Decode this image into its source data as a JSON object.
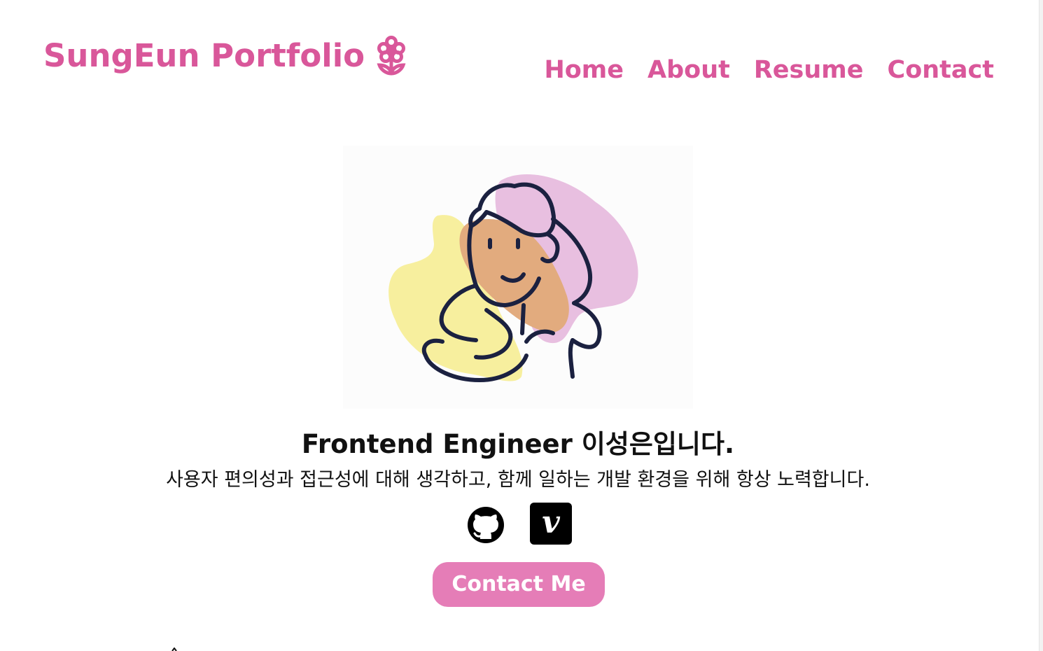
{
  "header": {
    "brand_text": "SungEun Portfolio",
    "brand_icon": "flower-icon",
    "nav": [
      {
        "label": "Home"
      },
      {
        "label": "About"
      },
      {
        "label": "Resume"
      },
      {
        "label": "Contact"
      }
    ]
  },
  "hero": {
    "avatar_icon": "girl-avatar-illustration",
    "headline": "Frontend Engineer 이성은입니다.",
    "subline": "사용자 편의성과 접근성에 대해 생각하고, 함께 일하는 개발 환경을 위해 항상 노력합니다.",
    "social": [
      {
        "icon": "github-icon"
      },
      {
        "icon": "velog-icon",
        "glyph": "v"
      }
    ],
    "cta_label": "Contact Me"
  },
  "colors": {
    "accent": "#d9579a",
    "button": "#e57db7",
    "text": "#111111",
    "avatar_pink": "#e8bfe0",
    "avatar_yellow": "#f7ef9e",
    "avatar_skin": "#e2ab7e",
    "avatar_line": "#1b2140"
  }
}
